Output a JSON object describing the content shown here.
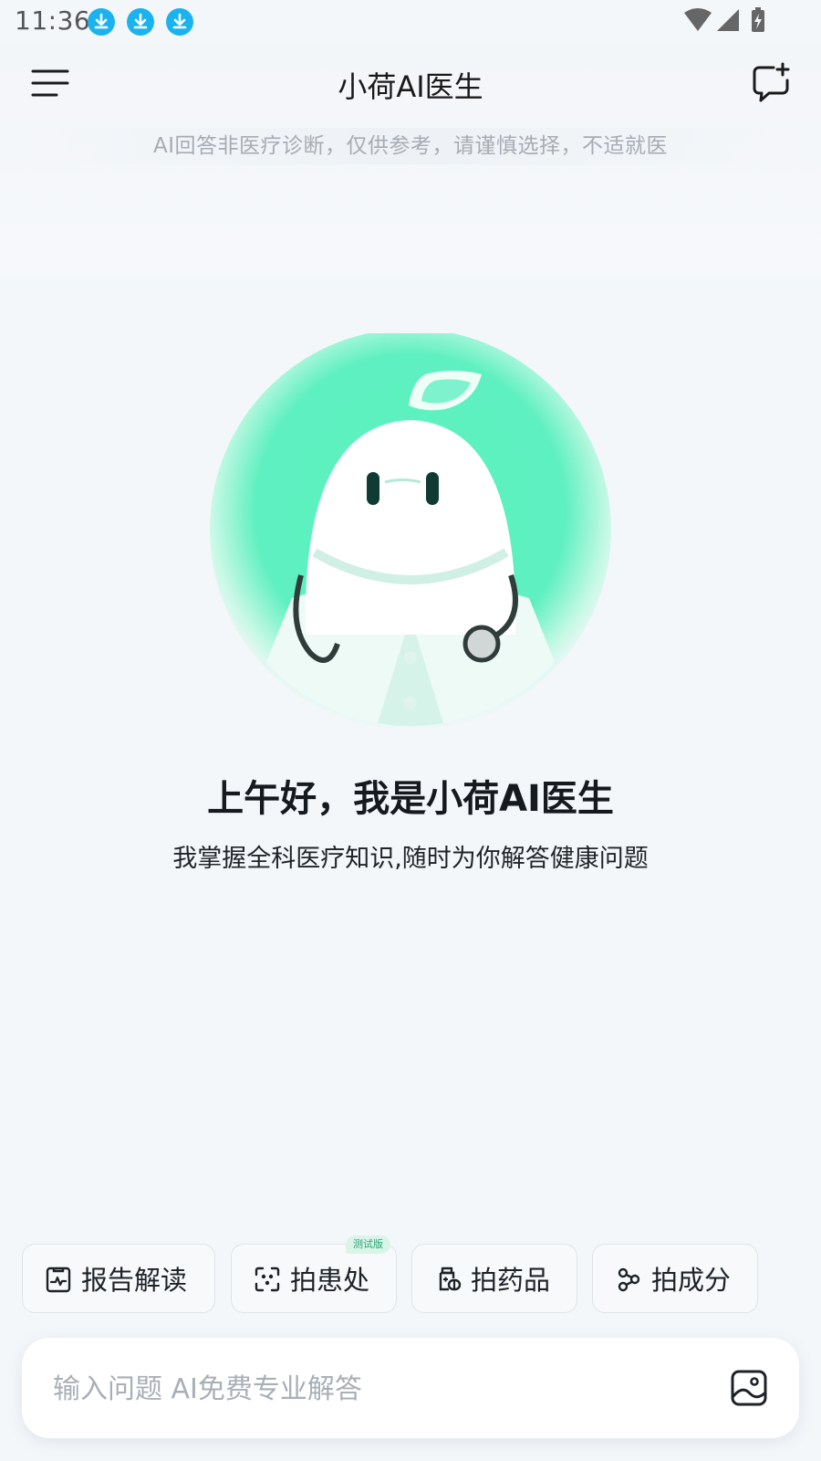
{
  "status_bar": {
    "time": "11:36",
    "icons": [
      "download-icon",
      "download-icon",
      "download-icon",
      "wifi-icon",
      "cell-signal-icon",
      "battery-charging-icon"
    ],
    "accent_color": "#1ab3f0"
  },
  "header": {
    "title": "小荷AI医生",
    "left_icon": "menu-icon",
    "right_icon": "new-chat-icon"
  },
  "disclaimer": "AI回答非医疗诊断，仅供参考，请谨慎选择，不适就医",
  "welcome": {
    "greeting": "上午好，我是小荷AI医生",
    "intro": "我掌握全科医疗知识,随时为你解答健康问题",
    "avatar_color": "#4ff0b8"
  },
  "quick_actions": [
    {
      "label": "报告解读",
      "icon": "report-icon"
    },
    {
      "label": "拍患处",
      "icon": "scan-icon",
      "badge": "测试版"
    },
    {
      "label": "拍药品",
      "icon": "medicine-icon"
    },
    {
      "label": "拍成分",
      "icon": "ingredient-icon"
    }
  ],
  "input": {
    "placeholder": "输入问题 AI免费专业解答",
    "value": "",
    "right_icon": "image-icon"
  }
}
